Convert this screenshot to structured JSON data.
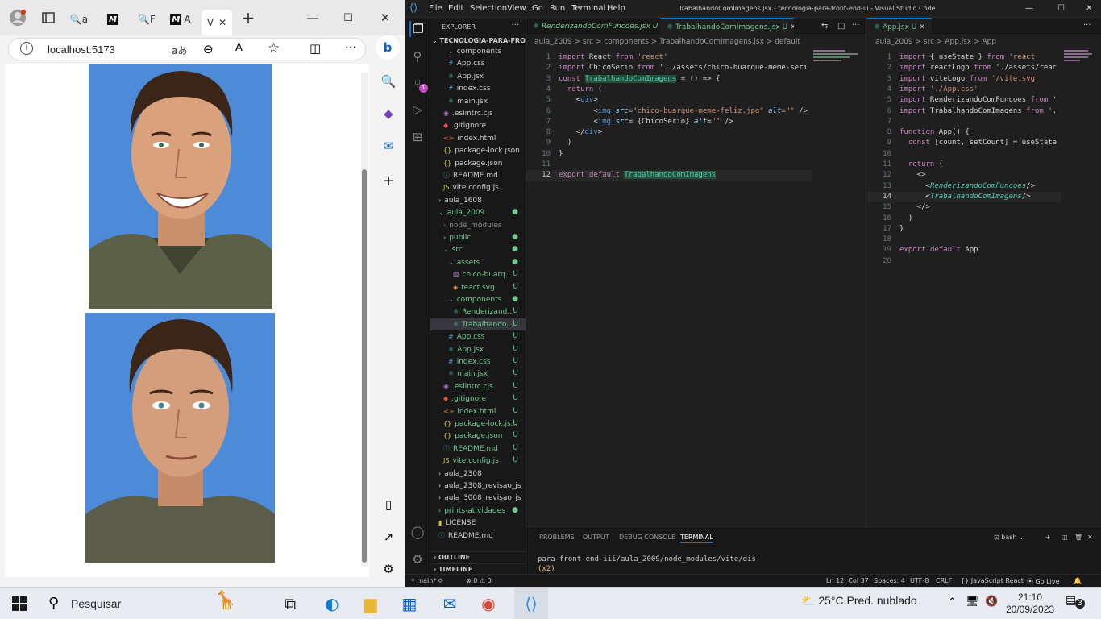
{
  "browser": {
    "address": "localhost:5173",
    "read_aloud": "aあ",
    "tab_labels": [
      "a",
      "F",
      "A",
      "V"
    ],
    "image_alt": ""
  },
  "vscode": {
    "menu": [
      "File",
      "Edit",
      "Selection",
      "View",
      "Go",
      "Run",
      "Terminal",
      "Help"
    ],
    "title": "TrabalhandoComImagens.jsx - tecnologia-para-front-end-iii - Visual Studio Code",
    "explorer_title": "EXPLORER",
    "project_name": "TECNOLOGIA-PARA-FRONT...",
    "tree": [
      {
        "label": "components",
        "type": "folder-open",
        "indent": 2,
        "u": ""
      },
      {
        "label": "App.css",
        "type": "css",
        "indent": 2,
        "u": ""
      },
      {
        "label": "App.jsx",
        "type": "jsx",
        "indent": 2,
        "u": ""
      },
      {
        "label": "index.css",
        "type": "css",
        "indent": 2,
        "u": ""
      },
      {
        "label": "main.jsx",
        "type": "jsx",
        "indent": 2,
        "u": ""
      },
      {
        "label": ".eslintrc.cjs",
        "type": "eslint",
        "indent": 1,
        "u": ""
      },
      {
        "label": ".gitignore",
        "type": "git",
        "indent": 1,
        "u": ""
      },
      {
        "label": "index.html",
        "type": "html",
        "indent": 1,
        "u": ""
      },
      {
        "label": "package-lock.json",
        "type": "json",
        "indent": 1,
        "u": ""
      },
      {
        "label": "package.json",
        "type": "json",
        "indent": 1,
        "u": ""
      },
      {
        "label": "README.md",
        "type": "md",
        "indent": 1,
        "u": ""
      },
      {
        "label": "vite.config.js",
        "type": "js",
        "indent": 1,
        "u": ""
      },
      {
        "label": "aula_1608",
        "type": "folder",
        "indent": 0,
        "u": ""
      },
      {
        "label": "aula_2009",
        "type": "folder-open-green",
        "indent": 0,
        "u": "●"
      },
      {
        "label": "node_modules",
        "type": "folder-gray",
        "indent": 1,
        "u": ""
      },
      {
        "label": "public",
        "type": "folder-green",
        "indent": 1,
        "u": "●"
      },
      {
        "label": "src",
        "type": "folder-open-green",
        "indent": 1,
        "u": "●"
      },
      {
        "label": "assets",
        "type": "folder-open-green",
        "indent": 2,
        "u": "●"
      },
      {
        "label": "chico-buarq...",
        "type": "img",
        "indent": 3,
        "u": "U"
      },
      {
        "label": "react.svg",
        "type": "svg",
        "indent": 3,
        "u": "U"
      },
      {
        "label": "components",
        "type": "folder-open-green",
        "indent": 2,
        "u": "●"
      },
      {
        "label": "Renderizand...",
        "type": "jsx",
        "indent": 3,
        "u": "U"
      },
      {
        "label": "Trabalhando...",
        "type": "jsx-selected",
        "indent": 3,
        "u": "U"
      },
      {
        "label": "App.css",
        "type": "css",
        "indent": 2,
        "u": "U"
      },
      {
        "label": "App.jsx",
        "type": "jsx",
        "indent": 2,
        "u": "U"
      },
      {
        "label": "index.css",
        "type": "css",
        "indent": 2,
        "u": "U"
      },
      {
        "label": "main.jsx",
        "type": "jsx",
        "indent": 2,
        "u": "U"
      },
      {
        "label": ".eslintrc.cjs",
        "type": "eslint",
        "indent": 1,
        "u": "U"
      },
      {
        "label": ".gitignore",
        "type": "git",
        "indent": 1,
        "u": "U"
      },
      {
        "label": "index.html",
        "type": "html",
        "indent": 1,
        "u": "U"
      },
      {
        "label": "package-lock.js...",
        "type": "json",
        "indent": 1,
        "u": "U"
      },
      {
        "label": "package.json",
        "type": "json",
        "indent": 1,
        "u": "U"
      },
      {
        "label": "README.md",
        "type": "md",
        "indent": 1,
        "u": "U"
      },
      {
        "label": "vite.config.js",
        "type": "js",
        "indent": 1,
        "u": "U"
      },
      {
        "label": "aula_2308",
        "type": "folder",
        "indent": 0,
        "u": ""
      },
      {
        "label": "aula_2308_revisao_js",
        "type": "folder",
        "indent": 0,
        "u": ""
      },
      {
        "label": "aula_3008_revisao_js",
        "type": "folder",
        "indent": 0,
        "u": ""
      },
      {
        "label": "prints-atividades",
        "type": "folder-green",
        "indent": 0,
        "u": "●"
      },
      {
        "label": "LICENSE",
        "type": "license",
        "indent": 0,
        "u": ""
      },
      {
        "label": "README.md",
        "type": "md",
        "indent": 0,
        "u": ""
      }
    ],
    "outline": "OUTLINE",
    "timeline": "TIMELINE",
    "left_editor": {
      "tabs": [
        {
          "label": "RenderizandoComFuncoes.jsx",
          "mark": "U",
          "active": false
        },
        {
          "label": "TrabalhandoComImagens.jsx",
          "mark": "U",
          "active": true
        }
      ],
      "breadcrumb": "aula_2009 > src > components > TrabalhandoComImagens.jsx > default",
      "lines": [
        "import React from 'react'",
        "import ChicoSerio from '../assets/chico-buarque-meme-seri",
        "const TrabalhandoComImagens = () => {",
        "  return (",
        "    <div>",
        "        <img src=\"chico-buarque-meme-feliz.jpg\" alt=\"\" />",
        "        <img src= {ChicoSerio} alt=\"\" />",
        "    </div>",
        "  )",
        "}",
        "",
        "export default TrabalhandoComImagens"
      ]
    },
    "right_editor": {
      "tab": "App.jsx",
      "tab_mark": "U",
      "breadcrumb": "aula_2009 > src > App.jsx > App",
      "lines": [
        "import { useState } from 'react'",
        "import reactLogo from './assets/reac",
        "import viteLogo from '/vite.svg'",
        "import './App.css'",
        "import RenderizandoComFuncoes from '",
        "import TrabalhandoComImagens from '.",
        "",
        "function App() {",
        "  const [count, setCount] = useState",
        "",
        "  return (",
        "    <>",
        "      <RenderizandoComFuncoes/>",
        "      <TrabalhandoComImagens/>",
        "    </>",
        "  )",
        "}",
        "",
        "export default App",
        ""
      ]
    },
    "panel": {
      "tabs": [
        "PROBLEMS",
        "OUTPUT",
        "DEBUG CONSOLE",
        "TERMINAL"
      ],
      "shell": "bash",
      "terminal_lines": [
        "para-front-end-iii/aula_2009/node_modules/vite/dis",
        "(x2)"
      ]
    },
    "status": {
      "branch": "main*",
      "errors": "0",
      "warnings": "0",
      "position": "Ln 12, Col 37",
      "spaces": "Spaces: 4",
      "encoding": "UTF-8",
      "eol": "CRLF",
      "language": "JavaScript React",
      "golive": "Go Live"
    },
    "badge": "1"
  },
  "taskbar": {
    "search": "Pesquisar",
    "weather": "25°C  Pred. nublado",
    "time": "21:10",
    "date": "20/09/2023",
    "notif": "3"
  },
  "colors": {
    "accent": "#0078d4",
    "modified": "#73c991",
    "photo_bg": "#4d8bd9"
  }
}
